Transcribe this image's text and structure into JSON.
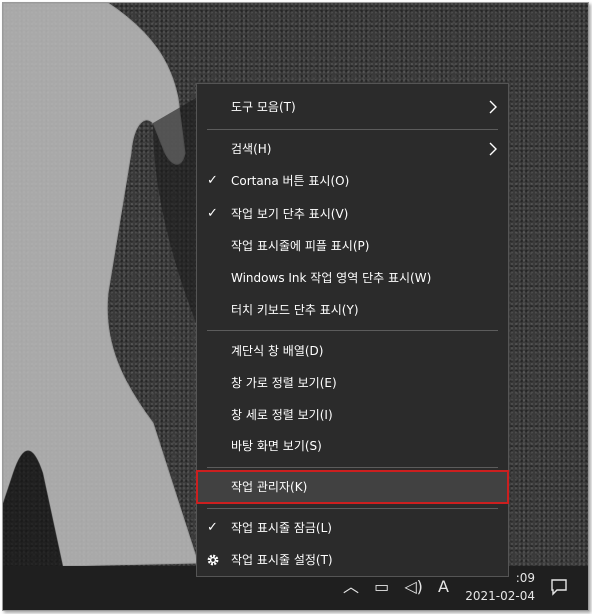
{
  "menu": {
    "items": [
      {
        "label": "도구 모음(T)",
        "checked": false,
        "submenu": true
      },
      {
        "label": "검색(H)",
        "checked": false,
        "submenu": true
      },
      {
        "label": "Cortana 버튼 표시(O)",
        "checked": true,
        "submenu": false
      },
      {
        "label": "작업 보기 단추 표시(V)",
        "checked": true,
        "submenu": false
      },
      {
        "label": "작업 표시줄에 피플 표시(P)",
        "checked": false,
        "submenu": false
      },
      {
        "label": "Windows Ink 작업 영역 단추 표시(W)",
        "checked": false,
        "submenu": false
      },
      {
        "label": "터치 키보드 단추 표시(Y)",
        "checked": false,
        "submenu": false
      },
      {
        "label": "계단식 창 배열(D)",
        "checked": false,
        "submenu": false
      },
      {
        "label": "창 가로 정렬 보기(E)",
        "checked": false,
        "submenu": false
      },
      {
        "label": "창 세로 정렬 보기(I)",
        "checked": false,
        "submenu": false
      },
      {
        "label": "바탕 화면 보기(S)",
        "checked": false,
        "submenu": false
      },
      {
        "label": "작업 관리자(K)",
        "checked": false,
        "submenu": false,
        "highlighted": true
      },
      {
        "label": "작업 표시줄 잠금(L)",
        "checked": true,
        "submenu": false
      },
      {
        "label": "작업 표시줄 설정(T)",
        "checked": false,
        "submenu": false,
        "icon": "gear-icon"
      }
    ],
    "check_glyph": "✓",
    "highlight_color": "#cc1f1f"
  },
  "taskbar": {
    "time": ":09",
    "date": "2021-02-04",
    "ime_indicator": "A",
    "tray_icons": [
      "chevron-up-icon",
      "network-icon",
      "battery-icon",
      "volume-icon"
    ],
    "notification_icon": "action-center-icon"
  }
}
